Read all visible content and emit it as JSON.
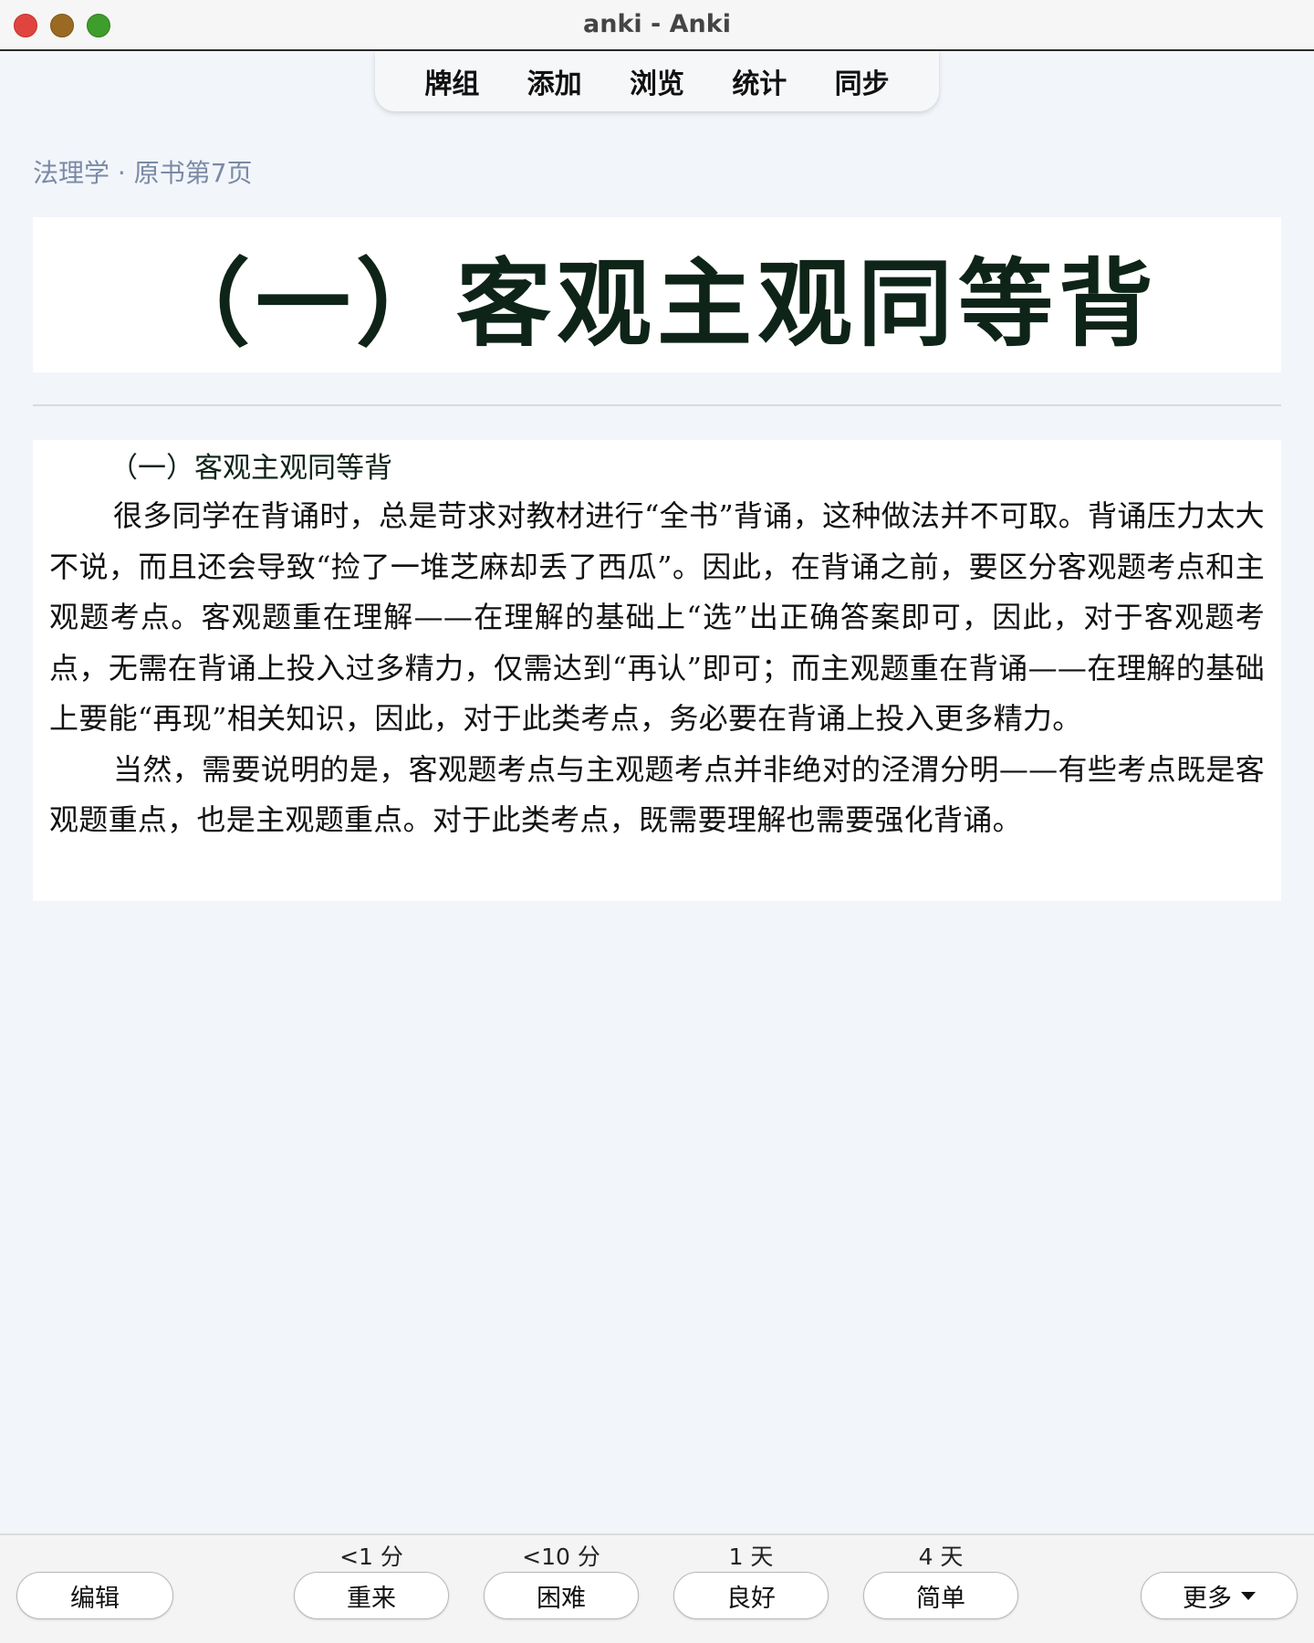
{
  "window": {
    "title": "anki - Anki"
  },
  "toolbar": {
    "items": [
      {
        "label": "牌组"
      },
      {
        "label": "添加"
      },
      {
        "label": "浏览"
      },
      {
        "label": "统计"
      },
      {
        "label": "同步"
      }
    ]
  },
  "card": {
    "deck_info": "法理学 · 原书第7页",
    "heading_image_text": "（一）客观主观同等背",
    "passage_title": "（一）客观主观同等背",
    "paragraphs": [
      "很多同学在背诵时，总是苛求对教材进行“全书”背诵，这种做法并不可取。背诵压力太大不说，而且还会导致“捡了一堆芝麻却丢了西瓜”。因此，在背诵之前，要区分客观题考点和主观题考点。客观题重在理解——在理解的基础上“选”出正确答案即可，因此，对于客观题考点，无需在背诵上投入过多精力，仅需达到“再认”即可；而主观题重在背诵——在理解的基础上要能“再现”相关知识，因此，对于此类考点，务必要在背诵上投入更多精力。",
      "当然，需要说明的是，客观题考点与主观题考点并非绝对的泾渭分明——有些考点既是客观题重点，也是主观题重点。对于此类考点，既需要理解也需要强化背诵。"
    ]
  },
  "answer_bar": {
    "edit_label": "编辑",
    "more_label": "更多",
    "buttons": [
      {
        "label": "重来",
        "interval": "<1 分"
      },
      {
        "label": "困难",
        "interval": "<10 分"
      },
      {
        "label": "良好",
        "interval": "1 天"
      },
      {
        "label": "简单",
        "interval": "4 天"
      }
    ]
  },
  "colors": {
    "background": "#f2f5fa",
    "deck_info": "#7a8aa6",
    "heading_text": "#0e2418",
    "close": "#e0443e",
    "minimize": "#9a6a22",
    "zoom": "#3f9d2c"
  },
  "icons": {
    "close": "close-icon",
    "minimize": "minimize-icon",
    "zoom": "zoom-icon",
    "more_caret": "chevron-down-icon"
  }
}
